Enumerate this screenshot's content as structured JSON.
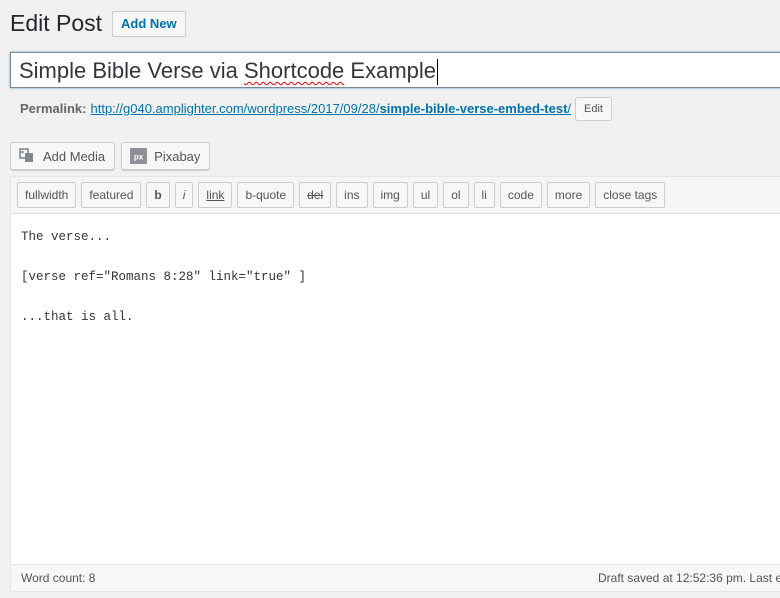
{
  "header": {
    "title": "Edit Post",
    "add_new_label": "Add New"
  },
  "post": {
    "title_plain": "Simple Bible Verse via ",
    "title_misspelled": "Shortcode",
    "title_tail": " Example"
  },
  "permalink": {
    "label": "Permalink:",
    "url_base": "http://g040.amplighter.com/wordpress/2017/09/28/",
    "slug": "simple-bible-verse-embed-test",
    "url_end": "/",
    "edit_label": "Edit"
  },
  "media_buttons": [
    {
      "label": "Add Media",
      "icon": "add-media-icon"
    },
    {
      "label": "Pixabay",
      "icon": "pixabay-icon"
    }
  ],
  "quicktags": [
    "fullwidth",
    "featured",
    "b",
    "i",
    "link",
    "b-quote",
    "del",
    "ins",
    "img",
    "ul",
    "ol",
    "li",
    "code",
    "more",
    "close tags"
  ],
  "content": {
    "line1": "The verse...",
    "line2": "[verse ref=\"Romans 8:28\" link=\"true\" ]",
    "line3": "...that is all."
  },
  "status": {
    "word_count": "Word count: 8",
    "draft_saved": "Draft saved at 12:52:36 pm. Last ed"
  },
  "colors": {
    "link": "#0073aa",
    "background": "#f1f1f1"
  }
}
